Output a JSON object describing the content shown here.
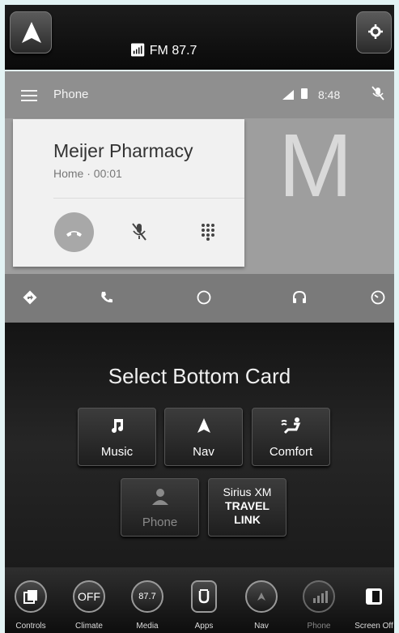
{
  "radio": {
    "label": "FM 87.7"
  },
  "android_auto": {
    "app_title": "Phone",
    "clock": "8:48",
    "call": {
      "name": "Meijer Pharmacy",
      "info": "Home · 00:01",
      "avatar_letter": "M"
    },
    "nav_icons": [
      "navigation-icon",
      "phone-icon",
      "home-circle-icon",
      "headphones-icon",
      "dashboard-icon"
    ]
  },
  "select_card": {
    "title": "Select Bottom Card",
    "buttons": [
      {
        "label": "Music",
        "icon": "music-note-icon"
      },
      {
        "label": "Nav",
        "icon": "navigation-arrow-icon"
      },
      {
        "label": "Comfort",
        "icon": "comfort-icon"
      },
      {
        "label": "Phone",
        "icon": "person-icon"
      }
    ],
    "sirius": {
      "line1": "Sirius XM",
      "line2": "TRAVEL",
      "line3": "LINK"
    }
  },
  "dock": {
    "items": [
      {
        "label": "Controls",
        "icon": "controls-icon"
      },
      {
        "label": "Climate",
        "icon": "climate-off-icon",
        "text": "OFF"
      },
      {
        "label": "Media",
        "icon": "media-icon",
        "text": "87.7"
      },
      {
        "label": "Apps",
        "icon": "apps-icon"
      },
      {
        "label": "Nav",
        "icon": "nav-icon"
      },
      {
        "label": "Phone",
        "icon": "phone-signal-icon"
      },
      {
        "label": "Screen Off",
        "icon": "screen-off-icon"
      }
    ]
  },
  "colors": {
    "page_background": "#e3f3f4",
    "aa_background": "#9e9e9e",
    "hangup": "#a8a8a8"
  }
}
